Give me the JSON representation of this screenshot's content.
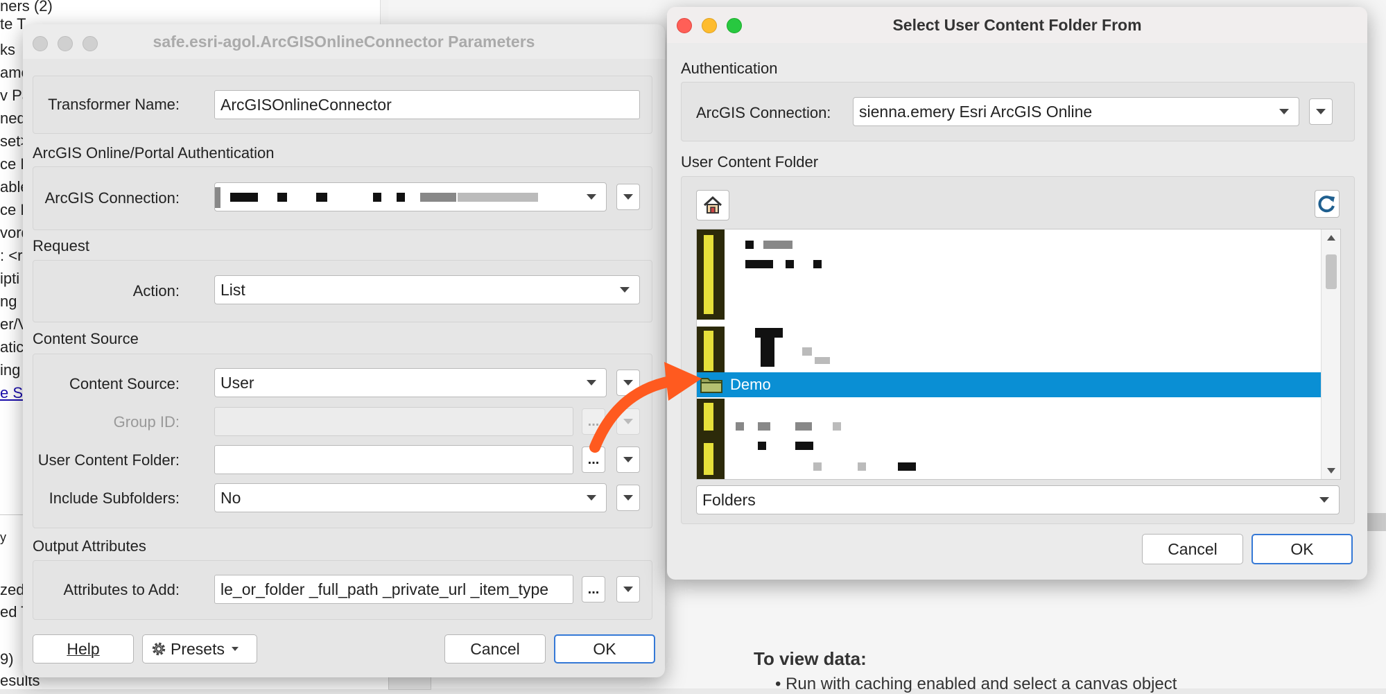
{
  "background": {
    "left_panel_rows": [
      "ners (2)",
      "te T",
      "ks",
      "ame",
      "v Pa",
      "ned",
      "set>",
      "ce F",
      "able",
      "ce F",
      "vord",
      ": <r",
      "ipti",
      "ng",
      "er/V",
      "atic",
      "ing",
      "e S"
    ],
    "bottom_rows": [
      "y",
      "zed",
      "ed T",
      "9)",
      "esults"
    ],
    "view_data_title": "To view data:",
    "view_data_bullet": "• Run with caching enabled and select a canvas object"
  },
  "params_dialog": {
    "title": "safe.esri-agol.ArcGISOnlineConnector Parameters",
    "transformer_name_label": "Transformer Name:",
    "transformer_name_value": "ArcGISOnlineConnector",
    "auth_group": "ArcGIS Online/Portal Authentication",
    "connection_label": "ArcGIS Connection:",
    "request_group": "Request",
    "action_label": "Action:",
    "action_value": "List",
    "content_group": "Content Source",
    "content_source_label": "Content Source:",
    "content_source_value": "User",
    "group_id_label": "Group ID:",
    "user_folder_label": "User Content Folder:",
    "include_subfolders_label": "Include Subfolders:",
    "include_subfolders_value": "No",
    "output_group": "Output Attributes",
    "attributes_label": "Attributes to Add:",
    "attributes_value": "le_or_folder _full_path _private_url _item_type",
    "ellipsis": "...",
    "help_button": "Help",
    "presets_button": "Presets",
    "cancel_button": "Cancel",
    "ok_button": "OK"
  },
  "folder_dialog": {
    "title": "Select User Content Folder From",
    "auth_group": "Authentication",
    "connection_label": "ArcGIS Connection:",
    "connection_value": "sienna.emery Esri ArcGIS Online",
    "folder_group": "User Content Folder",
    "selected_folder": "Demo",
    "filter_value": "Folders",
    "cancel_button": "Cancel",
    "ok_button": "OK"
  },
  "colors": {
    "selection": "#0a8fd4",
    "annotation_arrow": "#ff5a1f",
    "folder_icon": "#e6e03a"
  }
}
